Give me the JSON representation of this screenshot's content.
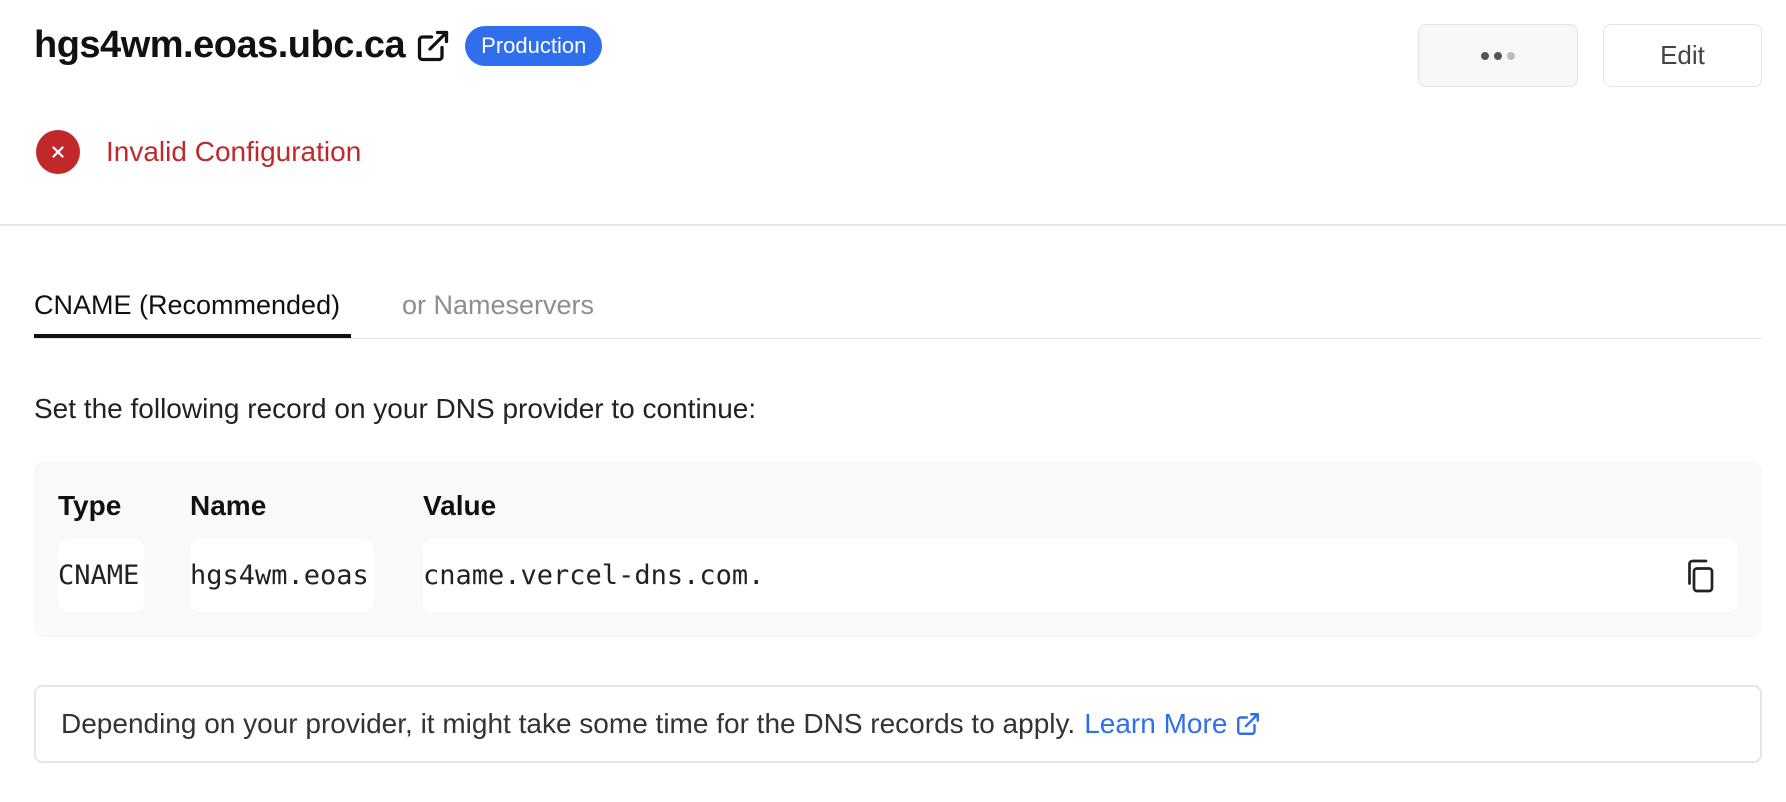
{
  "header": {
    "domain": "hgs4wm.eoas.ubc.ca",
    "external_link_icon": "external-link-icon",
    "environment_badge": "Production",
    "badge_color": "#2f6fed",
    "more_button_icon": "ellipsis-icon",
    "edit_label": "Edit"
  },
  "status": {
    "icon": "x-circle-icon",
    "text": "Invalid Configuration",
    "color": "#c0282a"
  },
  "tabs": [
    {
      "label": "CNAME (Recommended)",
      "active": true
    },
    {
      "label": "or Nameservers",
      "active": false
    }
  ],
  "instruction": "Set the following record on your DNS provider to continue:",
  "record": {
    "headers": {
      "type": "Type",
      "name": "Name",
      "value": "Value"
    },
    "type": "CNAME",
    "name": "hgs4wm.eoas",
    "value": "cname.vercel-dns.com.",
    "copy_icon": "copy-icon"
  },
  "note": {
    "text": "Depending on your provider, it might take some time for the DNS records to apply.",
    "link_label": "Learn More",
    "link_icon": "external-link-icon",
    "link_color": "#2f6fed"
  }
}
